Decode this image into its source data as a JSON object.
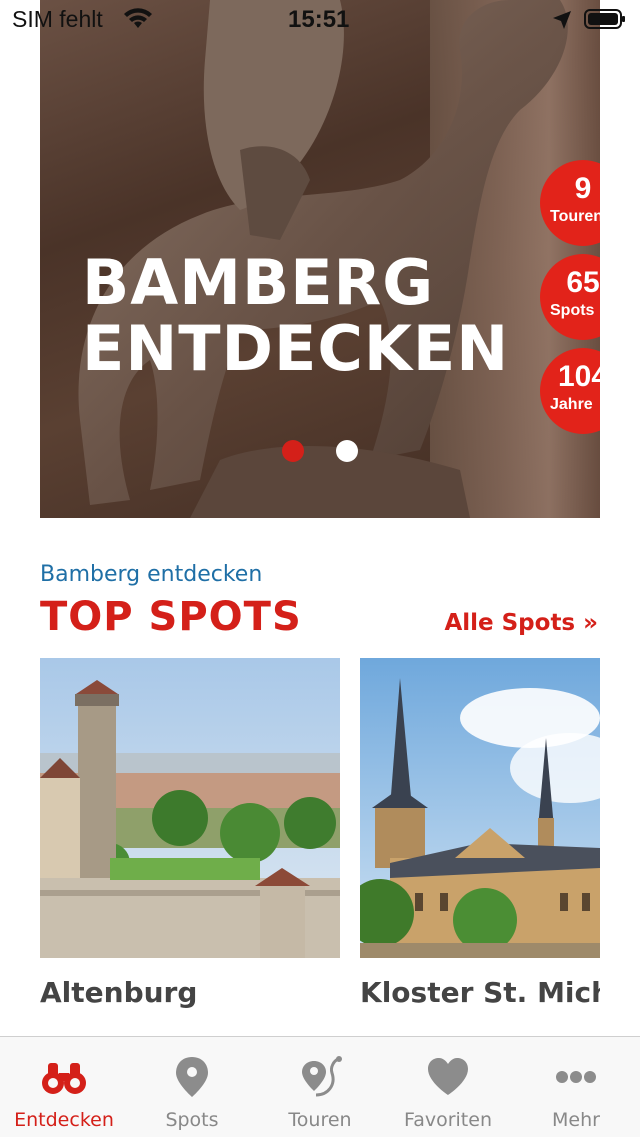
{
  "status_bar": {
    "carrier": "SIM fehlt",
    "time": "15:51"
  },
  "hero": {
    "title_line1": "BAMBERG",
    "title_line2": "ENTDECKEN",
    "badges": [
      {
        "number": "9",
        "label": "Touren"
      },
      {
        "number": "65",
        "label": "Spots"
      },
      {
        "number": "104",
        "label": "Jahre"
      }
    ],
    "carousel_page": 1,
    "carousel_total": 2
  },
  "section": {
    "subtitle": "Bamberg entdecken",
    "title": "TOP SPOTS",
    "all_link": "Alle Spots »"
  },
  "cards": [
    {
      "name": "Altenburg"
    },
    {
      "name": "Kloster St. Michael"
    }
  ],
  "tabbar": {
    "active": "Entdecken",
    "tabs": [
      {
        "label": "Entdecken",
        "icon": "binoculars-icon"
      },
      {
        "label": "Spots",
        "icon": "map-pin-icon"
      },
      {
        "label": "Touren",
        "icon": "route-icon"
      },
      {
        "label": "Favoriten",
        "icon": "heart-icon"
      },
      {
        "label": "Mehr",
        "icon": "more-dots-icon"
      }
    ]
  },
  "colors": {
    "accent": "#d42019",
    "link_blue": "#1f6fa6",
    "badge_red": "#e2231a"
  }
}
